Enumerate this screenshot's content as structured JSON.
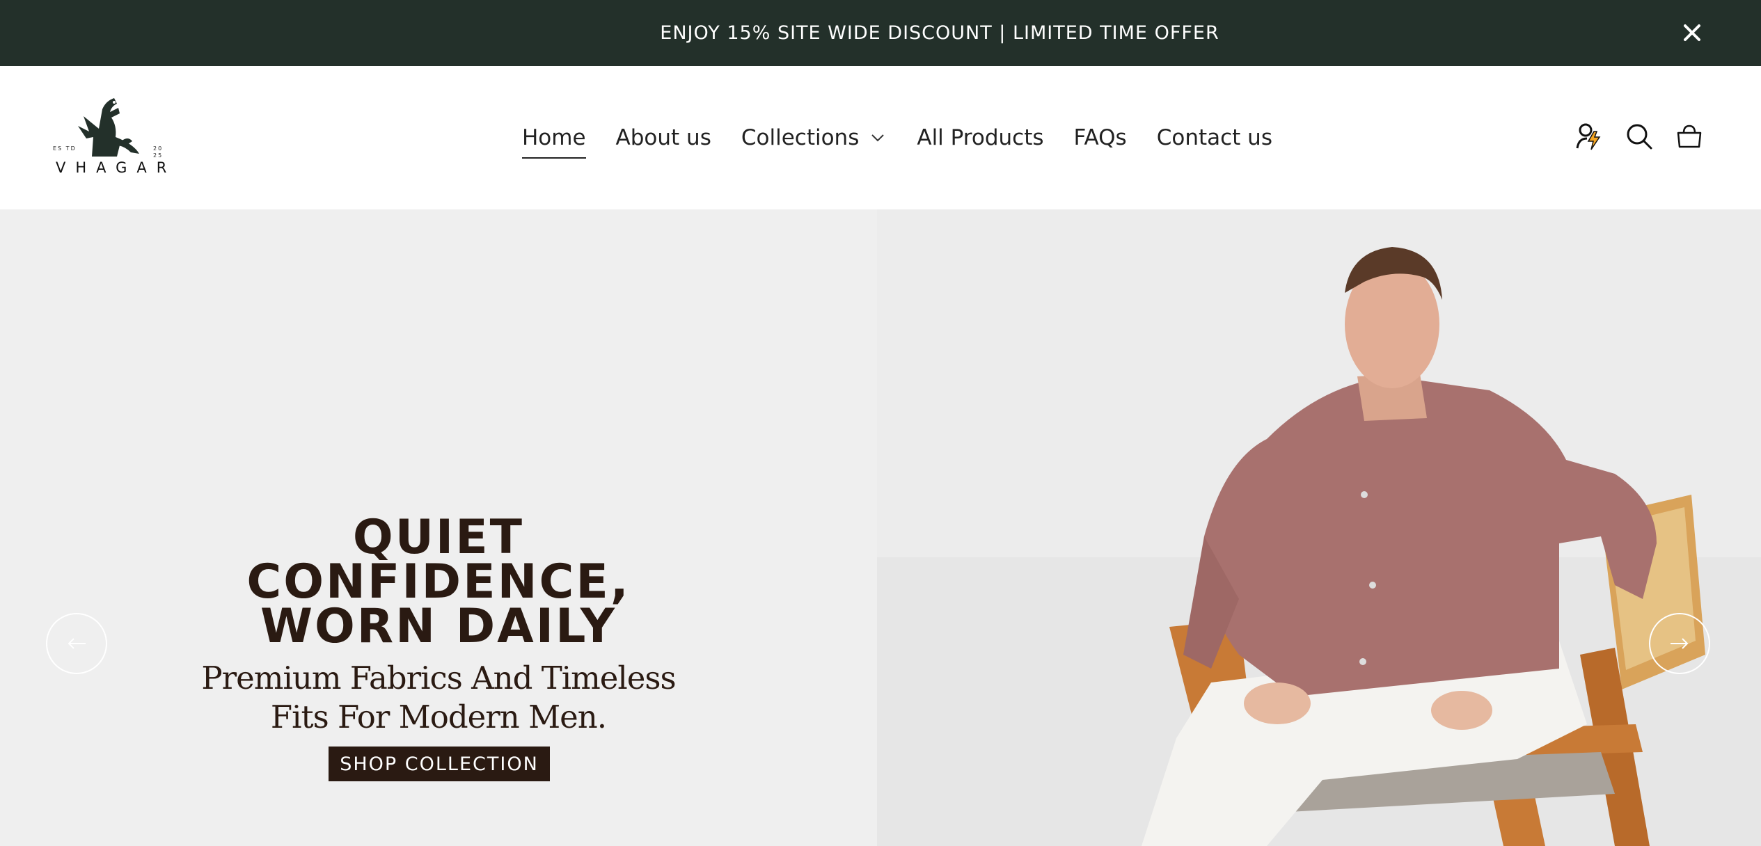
{
  "announcement": {
    "text": "ENJOY 15% SITE WIDE DISCOUNT | LIMITED TIME OFFER",
    "close_icon": "close-icon"
  },
  "brand": {
    "name": "VHAGAR",
    "est_label": "ES TD",
    "year_label": "20 25",
    "logo_icon": "dragon-icon"
  },
  "nav": {
    "items": [
      {
        "label": "Home",
        "active": true
      },
      {
        "label": "About us"
      },
      {
        "label": "Collections",
        "has_dropdown": true
      },
      {
        "label": "All Products"
      },
      {
        "label": "FAQs"
      },
      {
        "label": "Contact us"
      }
    ]
  },
  "header_icons": [
    "account-bolt-icon",
    "search-icon",
    "cart-bag-icon"
  ],
  "hero": {
    "headline_line1": "QUIET CONFIDENCE,",
    "headline_line2": "WORN DAILY",
    "sub_line1": "Premium Fabrics And Timeless",
    "sub_line2": "Fits For Modern Men.",
    "cta_label": "SHOP COLLECTION",
    "prev_icon": "arrow-left-icon",
    "next_icon": "arrow-right-icon"
  },
  "colors": {
    "announcement_bg": "#23302a",
    "hero_bg": "#efefef",
    "text_dark": "#2a1a12",
    "shirt": "#a8716e",
    "chair_wood": "#c87a36",
    "account_bolt": "#f5a623"
  }
}
